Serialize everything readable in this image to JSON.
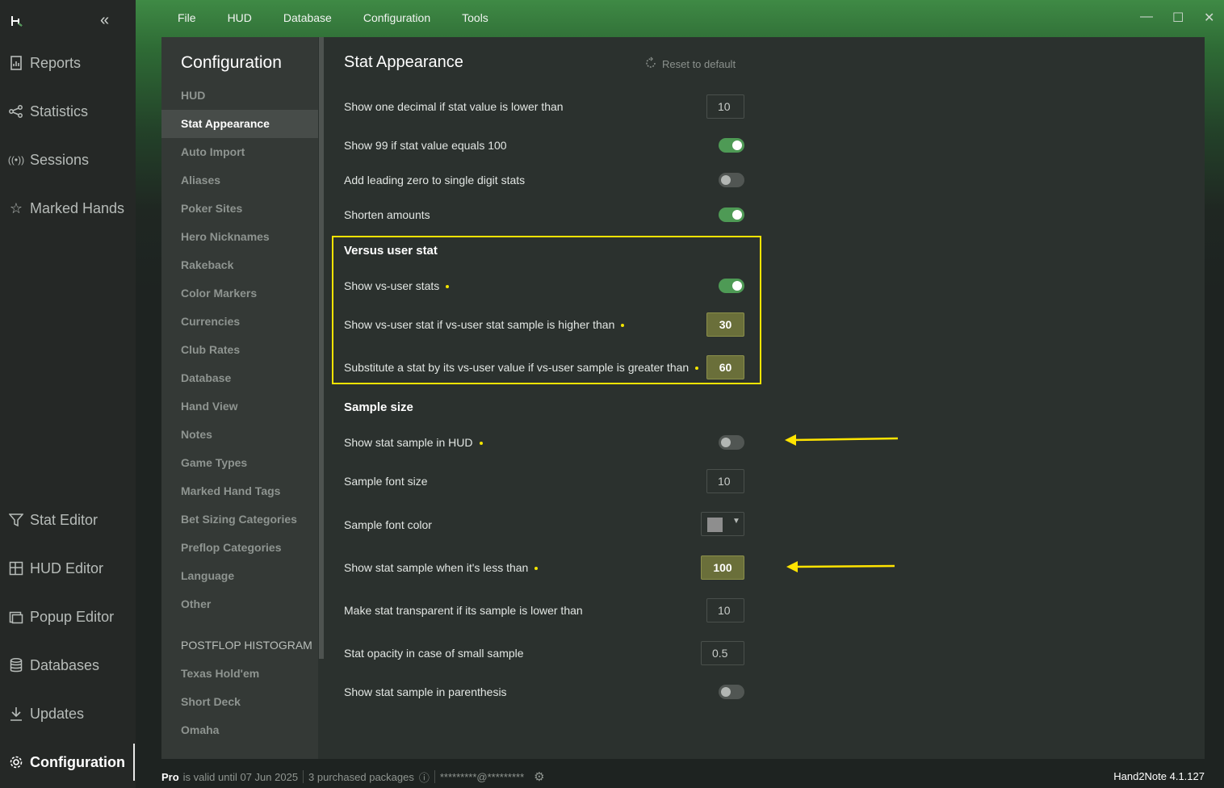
{
  "left_nav": {
    "items": [
      {
        "label": "Reports",
        "icon": "reports-icon"
      },
      {
        "label": "Statistics",
        "icon": "statistics-icon"
      },
      {
        "label": "Sessions",
        "icon": "sessions-icon"
      },
      {
        "label": "Marked Hands",
        "icon": "marked-hands-icon"
      }
    ],
    "bottom_items": [
      {
        "label": "Stat Editor",
        "icon": "filter-icon"
      },
      {
        "label": "HUD Editor",
        "icon": "hud-editor-icon"
      },
      {
        "label": "Popup Editor",
        "icon": "popup-editor-icon"
      },
      {
        "label": "Databases",
        "icon": "database-icon"
      },
      {
        "label": "Updates",
        "icon": "download-icon"
      },
      {
        "label": "Configuration",
        "icon": "gear-icon",
        "active": true
      }
    ]
  },
  "menu": [
    "File",
    "HUD",
    "Database",
    "Configuration",
    "Tools"
  ],
  "config_nav": {
    "title": "Configuration",
    "items": [
      "HUD",
      "Stat Appearance",
      "Auto Import",
      "Aliases",
      "Poker Sites",
      "Hero Nicknames",
      "Rakeback",
      "Color Markers",
      "Currencies",
      "Club Rates",
      "Database",
      "Hand View",
      "Notes",
      "Game Types",
      "Marked Hand Tags",
      "Bet Sizing Categories",
      "Preflop Categories",
      "Language",
      "Other"
    ],
    "selected": "Stat Appearance",
    "section": "POSTFLOP HISTOGRAM",
    "section_items": [
      "Texas Hold'em",
      "Short Deck",
      "Omaha"
    ]
  },
  "content": {
    "title": "Stat Appearance",
    "reset_label": "Reset to default",
    "rows": {
      "one_decimal": {
        "label": "Show one decimal if stat value is lower than",
        "value": "10"
      },
      "show99": {
        "label": "Show 99 if stat value equals 100",
        "on": true
      },
      "leading_zero": {
        "label": "Add leading zero to single digit stats",
        "on": false
      },
      "shorten": {
        "label": "Shorten amounts",
        "on": true
      }
    },
    "versus": {
      "heading": "Versus user stat",
      "show_vs": {
        "label": "Show vs-user stats",
        "on": true
      },
      "sample_higher": {
        "label": "Show vs-user stat if vs-user stat sample is higher than",
        "value": "30"
      },
      "substitute": {
        "label": "Substitute a stat by its vs-user value if vs-user sample is greater than",
        "value": "60"
      }
    },
    "sample": {
      "heading": "Sample size",
      "show_in_hud": {
        "label": "Show stat sample in HUD",
        "on": false
      },
      "font_size": {
        "label": "Sample font size",
        "value": "10"
      },
      "font_color": {
        "label": "Sample font color",
        "color": "#8e8e8e"
      },
      "less_than": {
        "label": "Show stat sample when it's less than",
        "value": "100"
      },
      "transparent": {
        "label": "Make stat transparent if its sample is lower than",
        "value": "10"
      },
      "opacity": {
        "label": "Stat opacity in case of small sample",
        "value": "0.5"
      },
      "parenthesis": {
        "label": "Show stat sample in parenthesis",
        "on": false
      }
    }
  },
  "status": {
    "plan": "Pro",
    "valid": "is valid until 07 Jun 2025",
    "packages": "3 purchased packages",
    "account": "*********@*********"
  },
  "version": "Hand2Note 4.1.127",
  "colors": {
    "accent": "#4e9a55",
    "highlight": "#ffe400"
  }
}
